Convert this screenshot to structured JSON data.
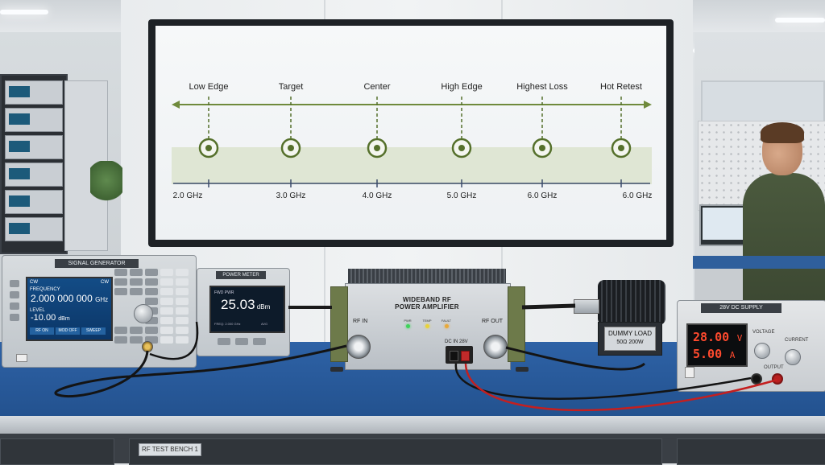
{
  "display": {
    "chart": {
      "labels": [
        "Low Edge",
        "Target",
        "Center",
        "High Edge",
        "Highest Loss",
        "Hot Retest"
      ],
      "ticks": [
        "2.0 GHz",
        "3.0 GHz",
        "4.0 GHz",
        "5.0 GHz",
        "6.0 GHz",
        "6.0 GHz"
      ]
    }
  },
  "signal_generator": {
    "label": "SIGNAL GENERATOR",
    "header_left": "CW",
    "header_right": "CW",
    "freq_label": "FREQUENCY",
    "frequency": "2.000 000 000",
    "freq_unit": "GHz",
    "level_label": "LEVEL",
    "level": "-10.00",
    "level_unit": "dBm",
    "softkeys": [
      "RF ON",
      "MOD OFF",
      "SWEEP"
    ]
  },
  "power_meter": {
    "label": "POWER METER",
    "reading_label": "FWD PWR",
    "reading": "25.03",
    "unit": "dBm",
    "freq": "FREQ: 2.000 GHz",
    "avg": "AVG"
  },
  "amplifier": {
    "title_line1": "WIDEBAND RF",
    "title_line2": "POWER AMPLIFIER",
    "rf_in": "RF IN",
    "rf_out": "RF OUT",
    "dc_in": "DC IN 28V",
    "leds": [
      {
        "label": "PWR",
        "color": "#3fd35a"
      },
      {
        "label": "TEMP",
        "color": "#e8d23a"
      },
      {
        "label": "FAULT",
        "color": "#e8a93a"
      }
    ]
  },
  "dummy_load": {
    "line1": "DUMMY LOAD",
    "line2": "50Ω  200W"
  },
  "dc_supply": {
    "label": "28V DC SUPPLY",
    "voltage": "28.00",
    "voltage_unit": "V",
    "current": "5.00",
    "current_unit": "A",
    "voltage_knob": "VOLTAGE",
    "current_knob": "CURRENT",
    "output": "OUTPUT"
  },
  "bench": {
    "label": "RF TEST BENCH 1"
  }
}
